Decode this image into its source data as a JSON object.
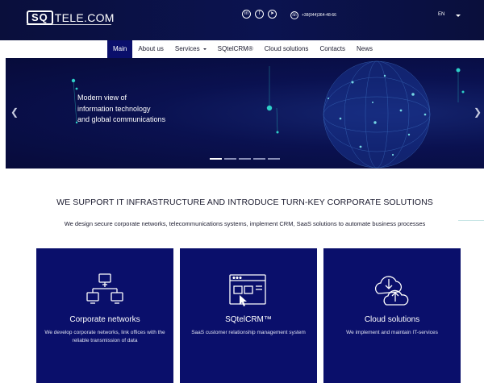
{
  "header": {
    "logo_mark": "SQ",
    "logo_text": "TELE.COM",
    "socials": [
      {
        "icon": "linkedin-icon",
        "glyph": "in"
      },
      {
        "icon": "facebook-icon",
        "glyph": "f"
      },
      {
        "icon": "telegram-icon",
        "glyph": "➤"
      }
    ],
    "phone_glyph": "☏",
    "phone": "+38(044)364-48-66",
    "language": "EN"
  },
  "nav": {
    "items": [
      {
        "label": "Main"
      },
      {
        "label": "About us"
      },
      {
        "label": "Services"
      },
      {
        "label": "SQtelCRM®"
      },
      {
        "label": "Cloud solutions"
      },
      {
        "label": "Contacts"
      },
      {
        "label": "News"
      }
    ]
  },
  "hero": {
    "lines": [
      "Modern view of",
      "information technology",
      "and global communications"
    ],
    "arrow_left": "❮",
    "arrow_right": "❯",
    "slide_count": 5,
    "active_slide": 1
  },
  "section": {
    "title": "WE SUPPORT IT INFRASTRUCTURE AND INTRODUCE TURN-KEY CORPORATE SOLUTIONS",
    "subtitle": "We design secure corporate networks, telecommunications systems, implement CRM, SaaS solutions to automate business processes"
  },
  "cards": [
    {
      "icon": "network-icon",
      "title": "Corporate networks",
      "description": "We develop corporate networks, link offices with the reliable transmission of data"
    },
    {
      "icon": "crm-window-icon",
      "title": "SQtelCRM™",
      "description": "SaaS customer relationship management system"
    },
    {
      "icon": "cloud-icon",
      "title": "Cloud solutions",
      "description": "We implement and maintain IT-services"
    }
  ],
  "colors": {
    "header_bg": "#0a0f3c",
    "nav_active_bg": "#0a0f6b",
    "card_bg": "#0a0f6b",
    "accent_teal": "#2ecfc8"
  }
}
